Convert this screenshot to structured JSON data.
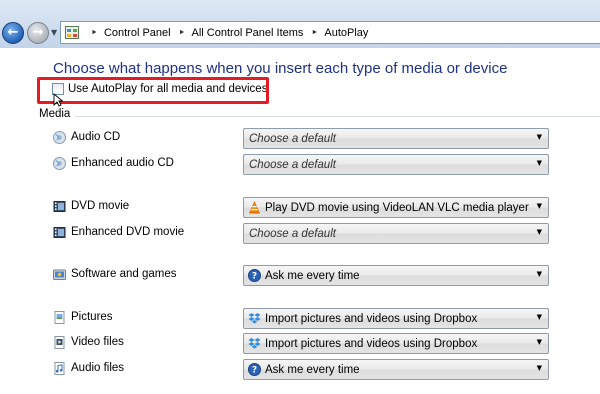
{
  "breadcrumb": {
    "items": [
      "Control Panel",
      "All Control Panel Items",
      "AutoPlay"
    ]
  },
  "page": {
    "heading": "Choose what happens when you insert each type of media or device",
    "autoplay_checkbox_label": "Use AutoPlay for all media and devices",
    "autoplay_checked": false,
    "section_media": "Media"
  },
  "media": [
    {
      "label": "Audio CD",
      "icon": "audio-cd-icon",
      "value": "Choose a default",
      "placeholder": true,
      "value_icon": ""
    },
    {
      "label": "Enhanced audio CD",
      "icon": "enhanced-audio-cd-icon",
      "value": "Choose a default",
      "placeholder": true,
      "value_icon": ""
    },
    {
      "label": "DVD movie",
      "icon": "dvd-movie-icon",
      "value": "Play DVD movie using VideoLAN VLC media player",
      "placeholder": false,
      "value_icon": "vlc-icon"
    },
    {
      "label": "Enhanced DVD movie",
      "icon": "enhanced-dvd-movie-icon",
      "value": "Choose a default",
      "placeholder": true,
      "value_icon": ""
    },
    {
      "label": "Software and games",
      "icon": "software-games-icon",
      "value": "Ask me every time",
      "placeholder": false,
      "value_icon": "ask-icon"
    },
    {
      "label": "Pictures",
      "icon": "pictures-icon",
      "value": "Import pictures and videos using Dropbox",
      "placeholder": false,
      "value_icon": "dropbox-icon"
    },
    {
      "label": "Video files",
      "icon": "video-files-icon",
      "value": "Import pictures and videos using Dropbox",
      "placeholder": false,
      "value_icon": "dropbox-icon"
    },
    {
      "label": "Audio files",
      "icon": "audio-files-icon",
      "value": "Ask me every time",
      "placeholder": false,
      "value_icon": "ask-icon"
    }
  ],
  "colors": {
    "heading": "#1e3287",
    "highlight": "#e21c24"
  }
}
